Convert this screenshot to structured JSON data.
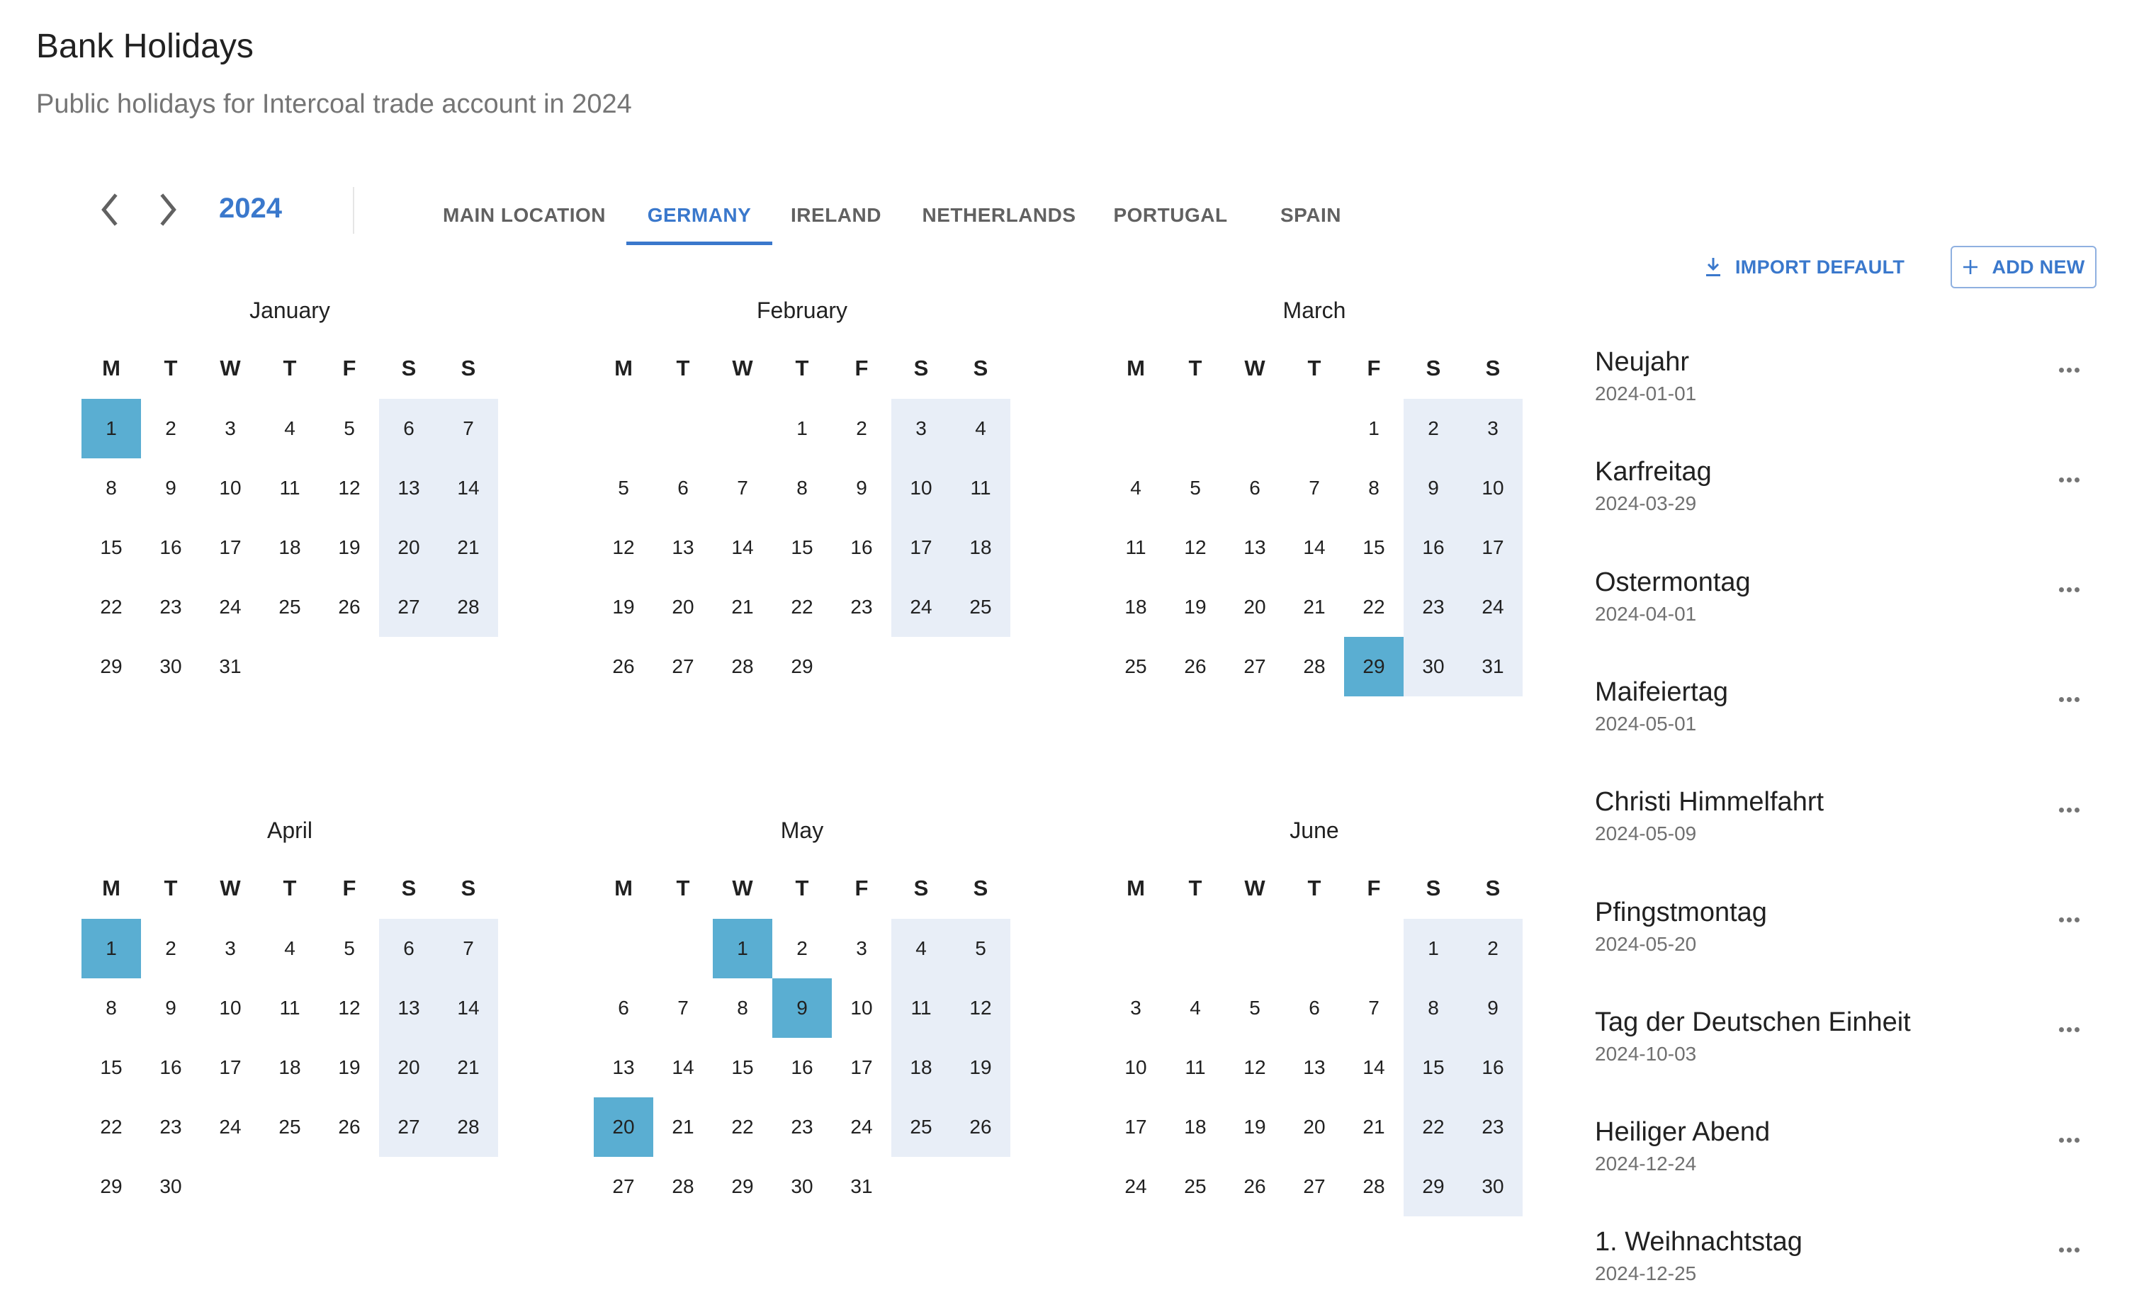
{
  "header": {
    "title": "Bank Holidays",
    "subtitle": "Public holidays for Intercoal trade account in 2024"
  },
  "toolbar": {
    "prev_icon": "chevron-left-icon",
    "next_icon": "chevron-right-icon",
    "year": "2024",
    "tabs": [
      {
        "label": "MAIN LOCATION",
        "active": false
      },
      {
        "label": "GERMANY",
        "active": true
      },
      {
        "label": "IRELAND",
        "active": false
      },
      {
        "label": "NETHERLANDS",
        "active": false
      },
      {
        "label": "PORTUGAL",
        "active": false
      },
      {
        "label": "SPAIN",
        "active": false
      }
    ],
    "import_label": "IMPORT DEFAULT",
    "import_icon": "download-icon",
    "add_label": "ADD NEW",
    "add_icon": "plus-icon"
  },
  "colors": {
    "accent": "#3a78cc",
    "holiday": "#5aaed2",
    "weekend": "#e8eef7"
  },
  "calendar": {
    "weekdays": [
      "M",
      "T",
      "W",
      "T",
      "F",
      "S",
      "S"
    ],
    "months": [
      {
        "name": "January",
        "first_weekday": 0,
        "days": 31,
        "holidays": [
          1
        ]
      },
      {
        "name": "February",
        "first_weekday": 3,
        "days": 29,
        "holidays": []
      },
      {
        "name": "March",
        "first_weekday": 4,
        "days": 31,
        "holidays": [
          29
        ]
      },
      {
        "name": "April",
        "first_weekday": 0,
        "days": 30,
        "holidays": [
          1
        ]
      },
      {
        "name": "May",
        "first_weekday": 2,
        "days": 31,
        "holidays": [
          1,
          9,
          20
        ]
      },
      {
        "name": "June",
        "first_weekday": 5,
        "days": 30,
        "holidays": []
      }
    ]
  },
  "holidays": [
    {
      "name": "Neujahr",
      "date": "2024-01-01"
    },
    {
      "name": "Karfreitag",
      "date": "2024-03-29"
    },
    {
      "name": "Ostermontag",
      "date": "2024-04-01"
    },
    {
      "name": "Maifeiertag",
      "date": "2024-05-01"
    },
    {
      "name": "Christi Himmelfahrt",
      "date": "2024-05-09"
    },
    {
      "name": "Pfingstmontag",
      "date": "2024-05-20"
    },
    {
      "name": "Tag der Deutschen Einheit",
      "date": "2024-10-03"
    },
    {
      "name": "Heiliger Abend",
      "date": "2024-12-24"
    },
    {
      "name": "1. Weihnachtstag",
      "date": "2024-12-25"
    }
  ]
}
